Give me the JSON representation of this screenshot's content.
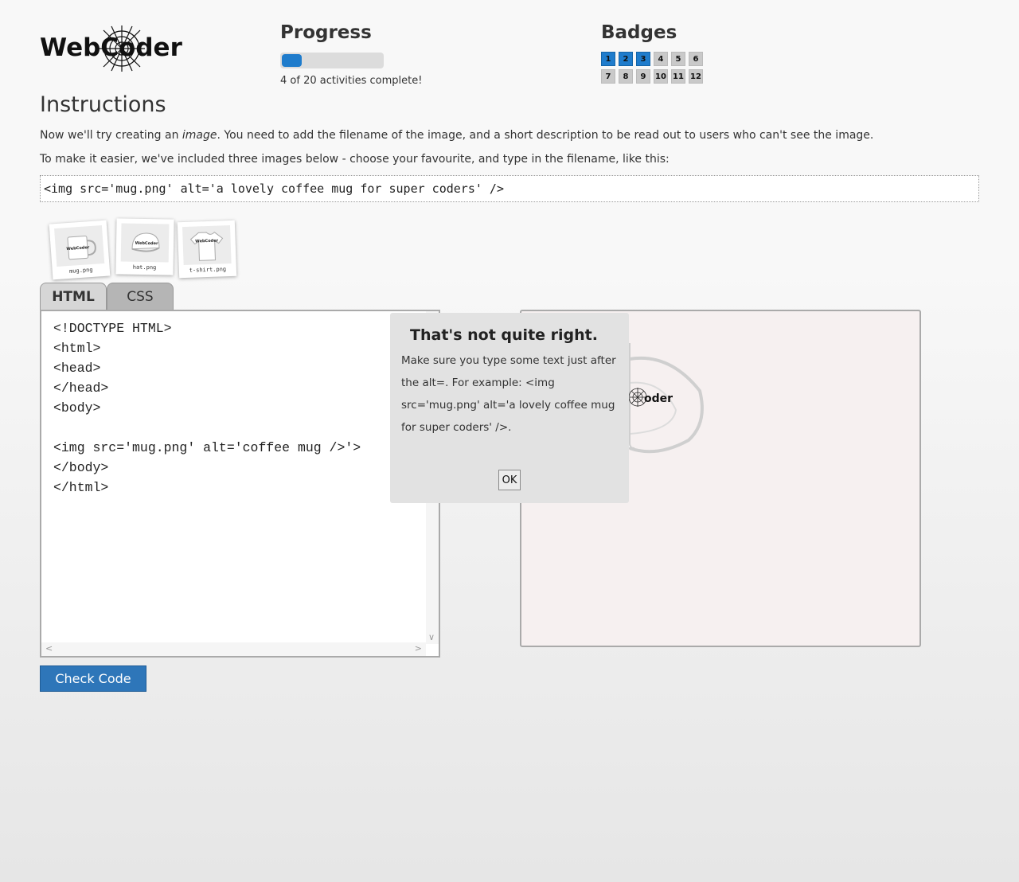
{
  "logo": {
    "text": "WebCoder"
  },
  "progress": {
    "title": "Progress",
    "completed": 4,
    "total": 20,
    "text": "4 of 20 activities complete!"
  },
  "badges": {
    "title": "Badges",
    "items": [
      {
        "label": "1",
        "earned": true
      },
      {
        "label": "2",
        "earned": true
      },
      {
        "label": "3",
        "earned": true
      },
      {
        "label": "4",
        "earned": false
      },
      {
        "label": "5",
        "earned": false
      },
      {
        "label": "6",
        "earned": false
      },
      {
        "label": "7",
        "earned": false
      },
      {
        "label": "8",
        "earned": false
      },
      {
        "label": "9",
        "earned": false
      },
      {
        "label": "10",
        "earned": false
      },
      {
        "label": "11",
        "earned": false
      },
      {
        "label": "12",
        "earned": false
      }
    ]
  },
  "instructions": {
    "title": "Instructions",
    "p1_before": "Now we'll try creating an ",
    "p1_em": "image",
    "p1_after": ". You need to add the filename of the image, and a short description to be read out to users who can't see the image.",
    "p2": "To make it easier, we've included three images below - choose your favourite, and type in the filename, like this:",
    "example_code": "<img src='mug.png' alt='a lovely coffee mug for super coders' />"
  },
  "images": [
    {
      "caption": "mug.png",
      "icon": "mug-icon"
    },
    {
      "caption": "hat.png",
      "icon": "hat-icon"
    },
    {
      "caption": "t-shirt.png",
      "icon": "tshirt-icon"
    }
  ],
  "tabs": [
    {
      "label": "HTML",
      "active": true
    },
    {
      "label": "CSS",
      "active": false
    }
  ],
  "editor": {
    "code": "<!DOCTYPE HTML>\n<html>\n<head>\n</head>\n<body>\n\n<img src='mug.png' alt='coffee mug />'>\n</body>\n</html>"
  },
  "preview": {
    "mug_brand": "oder"
  },
  "dialog": {
    "title": "That's not quite right.",
    "message": "Make sure you type some text just after the alt=. For example: <img src='mug.png' alt='a lovely coffee mug for super coders' />.",
    "ok_label": "OK"
  },
  "check_button": {
    "label": "Check Code"
  },
  "colors": {
    "accent": "#1f7ccc",
    "button": "#2e76b9",
    "badge_off": "#c9c9c9"
  }
}
